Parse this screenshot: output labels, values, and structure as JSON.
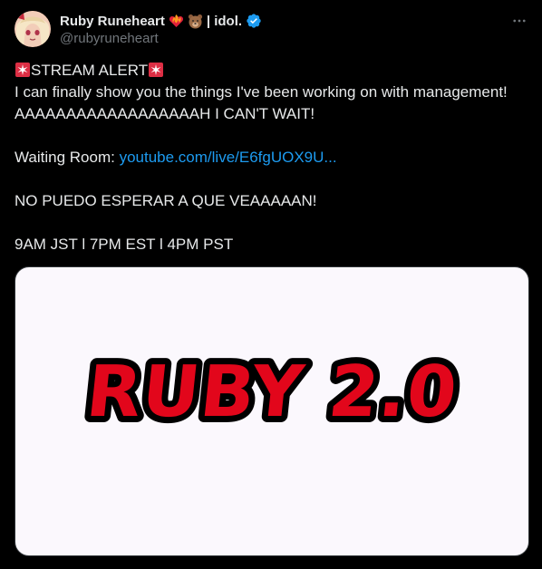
{
  "author": {
    "display_name": "Ruby Runeheart",
    "name_suffix": "| idol.",
    "handle": "@rubyruneheart",
    "emojis": [
      "heart-on-fire-emoji",
      "bear-emoji"
    ],
    "verified": true
  },
  "tweet": {
    "alert_text": "STREAM ALERT",
    "line_1": "I can finally show you the things I've been working on with management!",
    "line_2": "AAAAAAAAAAAAAAAAAAH I CAN'T WAIT!",
    "waiting_label": "Waiting Room: ",
    "waiting_link": "youtube.com/live/E6fgUOX9U...",
    "spanish_line": "NO PUEDO ESPERAR A QUE VEAAAAAN!",
    "schedule": "9AM JST l 7PM EST l 4PM PST"
  },
  "media": {
    "image_text": "RUBY 2.0"
  },
  "colors": {
    "background": "#000000",
    "text": "#e7e9ea",
    "muted": "#71767b",
    "link": "#1d9bf0",
    "verified": "#1d9bf0",
    "logo_red": "#e2061b"
  },
  "icons": [
    "verified-badge-icon",
    "more-options-icon",
    "siren-emoji"
  ]
}
